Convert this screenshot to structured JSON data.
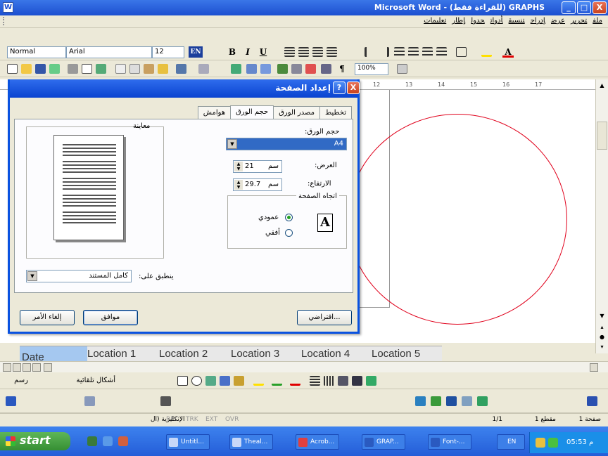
{
  "window": {
    "title": "Microsoft Word - (للقراءة فقط) GRAPHS",
    "min": "_",
    "max": "□",
    "close": "X"
  },
  "menubar": {
    "items": [
      "ملف",
      "تحرير",
      "عرض",
      "إدراج",
      "تنسيق",
      "أدوات",
      "جدول",
      "إطار",
      "تعليمات"
    ]
  },
  "format_toolbar": {
    "style": "Normal",
    "font": "Arial",
    "size": "12",
    "lang": "EN",
    "bold": "B",
    "italic": "I",
    "underline": "U"
  },
  "standard_toolbar": {
    "zoom": "100%"
  },
  "ruler": {
    "ticks": [
      "12",
      "13",
      "14",
      "15",
      "16",
      "17"
    ]
  },
  "dialog": {
    "title": "إعداد الصفحة",
    "tabs": [
      "هوامش",
      "حجم الورق",
      "مصدر الورق",
      "تخطيط"
    ],
    "active_tab": 1,
    "preview_label": "معاينة",
    "paper_size_label": "حجم الورق:",
    "paper_size_value": "A4",
    "width_label": "العرض:",
    "width_value": "21",
    "width_unit": "سم",
    "height_label": "الارتفاع:",
    "height_value": "29.7",
    "height_unit": "سم",
    "orientation_label": "اتجاه الصفحة",
    "portrait_label": "عمودي",
    "landscape_label": "أفقي",
    "orientation_icon": "A",
    "apply_label": "ينطبق على:",
    "apply_value": "كامل المستند",
    "default_button": "افتراضي...",
    "ok_button": "موافق",
    "cancel_button": "إلغاء الأمر"
  },
  "locations": [
    "Location 1",
    "Location 2",
    "Location 3",
    "Location 4",
    "Location 5"
  ],
  "drawing_toolbar": {
    "draw_label": "رسم",
    "autoshapes_label": "أشكال تلقائية"
  },
  "status": {
    "page": "صفحة 1",
    "section": "مقطع 1",
    "page_of": "1/1",
    "lang": "الإنكليزية (ال",
    "modes": [
      "REC",
      "TRK",
      "EXT",
      "OVR"
    ]
  },
  "taskbar": {
    "start": "start",
    "tasks": [
      "Untitl...",
      "Theal...",
      "Acrob...",
      "GRAP...",
      "Font-...",
      "EN"
    ],
    "clock": "05:53 م"
  }
}
